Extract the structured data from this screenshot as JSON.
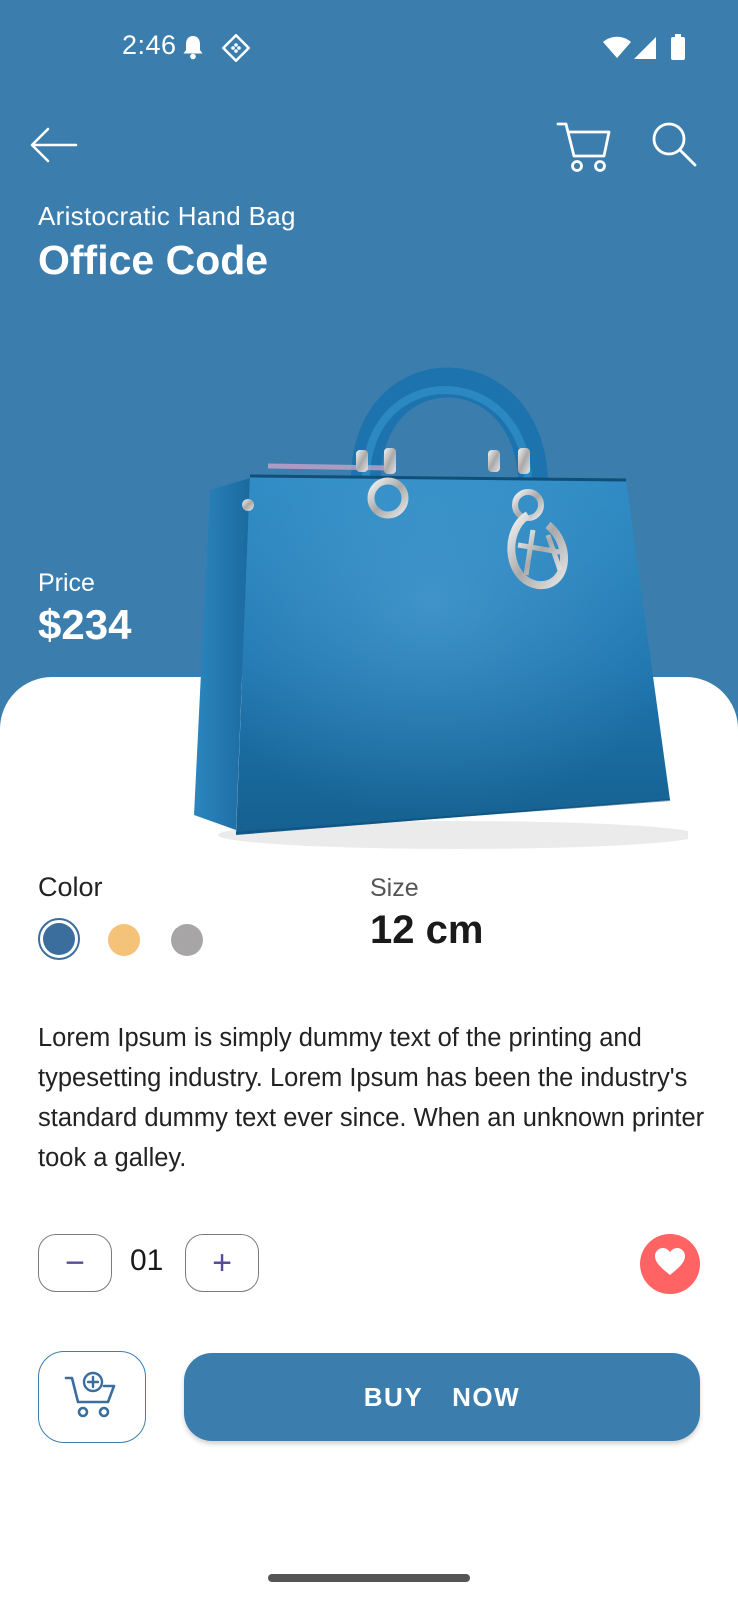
{
  "status_bar": {
    "time": "2:46",
    "icons": [
      "bell-icon",
      "diamond-notification-icon",
      "wifi-icon",
      "signal-icon",
      "battery-icon"
    ]
  },
  "toolbar": {
    "icons": [
      "back-arrow-icon",
      "cart-icon",
      "search-icon"
    ]
  },
  "product": {
    "subtitle": "Aristocratic Hand Bag",
    "title": "Office Code",
    "price_label": "Price",
    "price": "$234",
    "color_label": "Color",
    "colors": [
      "#3b6e9c",
      "#f5c27a",
      "#a8a5a6"
    ],
    "selected_color_index": 0,
    "size_label": "Size",
    "size": "12 cm",
    "description": "Lorem Ipsum is simply dummy text of the printing and typesetting industry. Lorem Ipsum has been the industry's standard dummy text ever since. When an unknown printer took a galley."
  },
  "quantity": {
    "decrement_label": "−",
    "value": "01",
    "increment_label": "+"
  },
  "actions": {
    "buy_label": "BUY  NOW",
    "add_to_cart_icon": "add-to-cart-icon",
    "favorite_icon": "heart-icon"
  },
  "theme": {
    "primary": "#3b7eae",
    "favorite": "#ff6363"
  }
}
